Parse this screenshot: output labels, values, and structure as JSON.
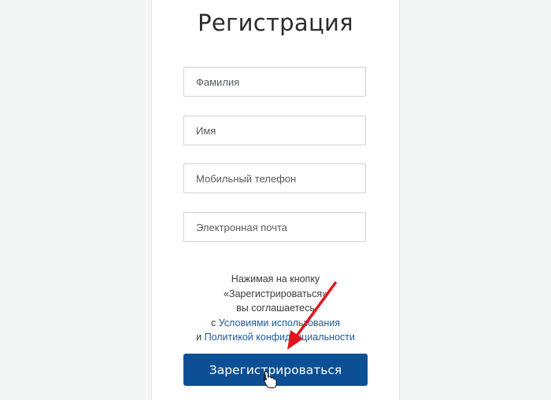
{
  "form": {
    "title": "Регистрация",
    "fields": [
      {
        "placeholder": "Фамилия",
        "value": ""
      },
      {
        "placeholder": "Имя",
        "value": ""
      },
      {
        "placeholder": "Мобильный телефон",
        "value": ""
      },
      {
        "placeholder": "Электронная почта",
        "value": ""
      }
    ],
    "agreement": {
      "line1": "Нажимая на кнопку",
      "line2": "«Зарегистрироваться»",
      "line3": "вы соглашаетесь",
      "prefix_terms": "с ",
      "terms_link": "Условиями использования",
      "prefix_privacy": "и ",
      "privacy_link": "Политикой конфиденциальности"
    },
    "submit_label": "Зарегистрироваться"
  },
  "colors": {
    "background": "#f4f5f5",
    "card": "#ffffff",
    "primary_button": "#0c4f95",
    "link": "#1b5b99",
    "annotation_arrow": "#e0141e"
  },
  "icons": {
    "cursor": "hand-pointer-icon",
    "annotation": "red-arrow"
  }
}
